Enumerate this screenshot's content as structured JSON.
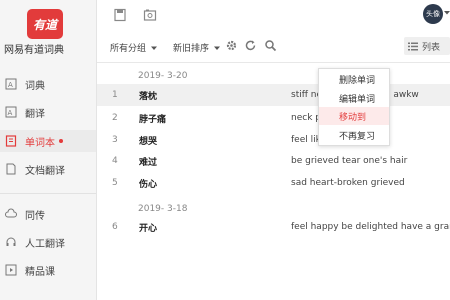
{
  "app": {
    "logo_text": "有道",
    "name": "网易有道词典"
  },
  "sidebar": {
    "items": [
      {
        "label": "词典",
        "icon": "dictionary-icon"
      },
      {
        "label": "翻译",
        "icon": "translate-icon"
      },
      {
        "label": "单词本",
        "icon": "wordbook-icon",
        "active": true,
        "badge_dot": true
      },
      {
        "label": "文档翻译",
        "icon": "document-icon"
      },
      {
        "label": "同传",
        "icon": "cloud-icon"
      },
      {
        "label": "人工翻译",
        "icon": "headset-icon"
      },
      {
        "label": "精品课",
        "icon": "play-icon"
      }
    ]
  },
  "header": {
    "avatar_text": "头像"
  },
  "toolbar": {
    "group_filter": "所有分组",
    "sort": "新旧排序",
    "view_mode": "列表"
  },
  "wordbook": {
    "groups": [
      {
        "date": "2019- 3-20",
        "entries": [
          {
            "num": "1",
            "word": "落枕",
            "def": "stiff ne                    an awkw"
          },
          {
            "num": "2",
            "word": "脖子痛",
            "def": "neck p"
          },
          {
            "num": "3",
            "word": "想哭",
            "def": "feel lik"
          },
          {
            "num": "4",
            "word": "难过",
            "def": "be grieved tear one's hair"
          },
          {
            "num": "5",
            "word": "伤心",
            "def": "sad heart-broken grieved"
          }
        ]
      },
      {
        "date": "2019- 3-18",
        "entries": [
          {
            "num": "6",
            "word": "开心",
            "def": "feel happy be delighted have a gran"
          }
        ]
      }
    ]
  },
  "context_menu": {
    "items": [
      "删除单词",
      "编辑单词",
      "移动到",
      "不再复习"
    ],
    "highlighted_index": 2
  },
  "colors": {
    "accent": "#e33b3b",
    "sidebar_bg": "#f5f5f5",
    "highlight_bg": "#f0f0f0"
  }
}
